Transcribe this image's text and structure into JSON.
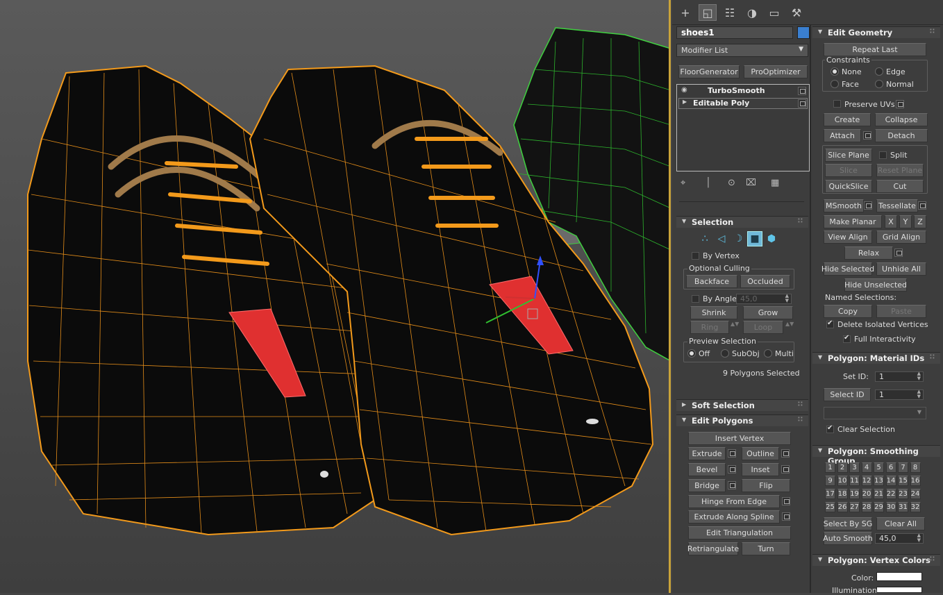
{
  "object": {
    "name": "shoes1",
    "color": "#3a7fd0"
  },
  "modifier_list": {
    "label": "Modifier List"
  },
  "quick_buttons": [
    "FloorGenerator",
    "ProOptimizer"
  ],
  "modifier_stack": [
    {
      "name": "TurboSmooth"
    },
    {
      "name": "Editable Poly"
    }
  ],
  "selection": {
    "title": "Selection",
    "by_vertex": "By Vertex",
    "optional_culling": "Optional Culling",
    "backface": "Backface",
    "occluded": "Occluded",
    "by_angle": "By Angle:",
    "by_angle_value": "45,0",
    "shrink": "Shrink",
    "grow": "Grow",
    "ring": "Ring",
    "loop": "Loop",
    "preview_selection": "Preview Selection",
    "preview_off": "Off",
    "preview_subobj": "SubObj",
    "preview_multi": "Multi",
    "status": "9 Polygons Selected"
  },
  "soft_selection": {
    "title": "Soft Selection"
  },
  "edit_polygons": {
    "title": "Edit Polygons",
    "insert_vertex": "Insert Vertex",
    "extrude": "Extrude",
    "outline": "Outline",
    "bevel": "Bevel",
    "inset": "Inset",
    "bridge": "Bridge",
    "flip": "Flip",
    "hinge": "Hinge From Edge",
    "extrude_spline": "Extrude Along Spline",
    "edit_tri": "Edit Triangulation",
    "retriangulate": "Retriangulate",
    "turn": "Turn"
  },
  "edit_geometry": {
    "title": "Edit Geometry",
    "repeat_last": "Repeat Last",
    "constraints": "Constraints",
    "c_none": "None",
    "c_edge": "Edge",
    "c_face": "Face",
    "c_normal": "Normal",
    "preserve_uvs": "Preserve UVs",
    "create": "Create",
    "collapse": "Collapse",
    "attach": "Attach",
    "detach": "Detach",
    "slice_plane": "Slice Plane",
    "split": "Split",
    "slice": "Slice",
    "reset_plane": "Reset Plane",
    "quickslice": "QuickSlice",
    "cut": "Cut",
    "msmooth": "MSmooth",
    "tessellate": "Tessellate",
    "make_planar": "Make Planar",
    "x": "X",
    "y": "Y",
    "z": "Z",
    "view_align": "View Align",
    "grid_align": "Grid Align",
    "relax": "Relax",
    "hide_selected": "Hide Selected",
    "unhide_all": "Unhide All",
    "hide_unselected": "Hide Unselected",
    "named_selections": "Named Selections:",
    "copy": "Copy",
    "paste": "Paste",
    "delete_isolated": "Delete Isolated Vertices",
    "full_interactivity": "Full Interactivity"
  },
  "material_ids": {
    "title": "Polygon: Material IDs",
    "set_id": "Set ID:",
    "set_id_value": "1",
    "select_id": "Select ID",
    "select_id_value": "1",
    "clear_selection": "Clear Selection"
  },
  "smoothing": {
    "title": "Polygon: Smoothing Group",
    "groups": [
      "1",
      "2",
      "3",
      "4",
      "5",
      "6",
      "7",
      "8",
      "9",
      "10",
      "11",
      "12",
      "13",
      "14",
      "15",
      "16",
      "17",
      "18",
      "19",
      "20",
      "21",
      "22",
      "23",
      "24",
      "25",
      "26",
      "27",
      "28",
      "29",
      "30",
      "31",
      "32"
    ],
    "select_by_sg": "Select By SG",
    "clear_all": "Clear All",
    "auto_smooth": "Auto Smooth",
    "auto_smooth_value": "45,0"
  },
  "vertex_colors": {
    "title": "Polygon: Vertex Colors",
    "color": "Color:",
    "illumination": "Illumination:"
  }
}
